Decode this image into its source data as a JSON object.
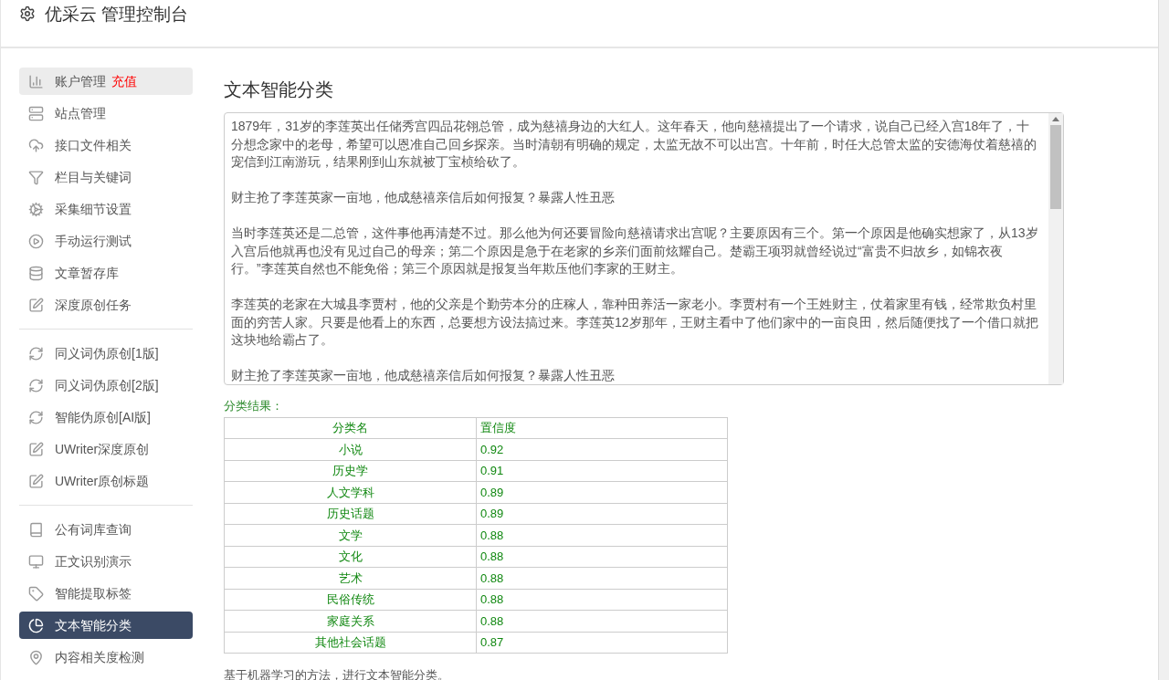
{
  "header": {
    "title": "优采云 管理控制台"
  },
  "sidebar": {
    "groups": [
      {
        "items": [
          {
            "label": "账户管理",
            "badge": "充值",
            "selected": false,
            "highlighted": true
          },
          {
            "label": "站点管理",
            "selected": false,
            "highlighted": false
          },
          {
            "label": "接口文件相关",
            "selected": false,
            "highlighted": false
          },
          {
            "label": "栏目与关键词",
            "selected": false,
            "highlighted": false
          },
          {
            "label": "采集细节设置",
            "selected": false,
            "highlighted": false
          },
          {
            "label": "手动运行测试",
            "selected": false,
            "highlighted": false
          },
          {
            "label": "文章暂存库",
            "selected": false,
            "highlighted": false
          },
          {
            "label": "深度原创任务",
            "selected": false,
            "highlighted": false
          }
        ]
      },
      {
        "items": [
          {
            "label": "同义词伪原创[1版]",
            "selected": false,
            "highlighted": false
          },
          {
            "label": "同义词伪原创[2版]",
            "selected": false,
            "highlighted": false
          },
          {
            "label": "智能伪原创[AI版]",
            "selected": false,
            "highlighted": false
          },
          {
            "label": "UWriter深度原创",
            "selected": false,
            "highlighted": false
          },
          {
            "label": "UWriter原创标题",
            "selected": false,
            "highlighted": false
          }
        ]
      },
      {
        "items": [
          {
            "label": "公有词库查询",
            "selected": false,
            "highlighted": false
          },
          {
            "label": "正文识别演示",
            "selected": false,
            "highlighted": false
          },
          {
            "label": "智能提取标签",
            "selected": false,
            "highlighted": false
          },
          {
            "label": "文本智能分类",
            "selected": true,
            "highlighted": false
          },
          {
            "label": "内容相关度检测",
            "selected": false,
            "highlighted": false
          }
        ]
      }
    ]
  },
  "main": {
    "title": "文本智能分类",
    "text_input": {
      "paragraphs": [
        "1879年，31岁的李莲英出任储秀宫四品花翎总管，成为慈禧身边的大红人。这年春天，他向慈禧提出了一个请求，说自己已经入宫18年了，十分想念家中的老母，希望可以恩准自己回乡探亲。当时清朝有明确的规定，太监无故不可以出宫。十年前，时任大总管太监的安德海仗着慈禧的宠信到江南游玩，结果刚到山东就被丁宝桢给砍了。",
        "财主抢了李莲英家一亩地，他成慈禧亲信后如何报复？暴露人性丑恶",
        "当时李莲英还是二总管，这件事他再清楚不过。那么他为何还要冒险向慈禧请求出宫呢？主要原因有三个。第一个原因是他确实想家了，从13岁入宫后他就再也没有见过自己的母亲；第二个原因是急于在老家的乡亲们面前炫耀自己。楚霸王项羽就曾经说过“富贵不归故乡，如锦衣夜行。”李莲英自然也不能免俗；第三个原因就是报复当年欺压他们李家的王财主。",
        "李莲英的老家在大城县李贾村，他的父亲是个勤劳本分的庄稼人，靠种田养活一家老小。李贾村有一个王姓财主，仗着家里有钱，经常欺负村里面的穷苦人家。只要是他看上的东西，总要想方设法搞过来。李莲英12岁那年，王财主看中了他们家中的一亩良田，然后随便找了一个借口就把这块地给霸占了。",
        "财主抢了李莲英家一亩地，他成慈禧亲信后如何报复？暴露人性丑恶"
      ]
    },
    "result_label": "分类结果：",
    "table": {
      "columns": [
        "分类名",
        "置信度"
      ],
      "rows": [
        [
          "小说",
          "0.92"
        ],
        [
          "历史学",
          "0.91"
        ],
        [
          "人文学科",
          "0.89"
        ],
        [
          "历史话题",
          "0.89"
        ],
        [
          "文学",
          "0.88"
        ],
        [
          "文化",
          "0.88"
        ],
        [
          "艺术",
          "0.88"
        ],
        [
          "民俗传统",
          "0.88"
        ],
        [
          "家庭关系",
          "0.88"
        ],
        [
          "其他社会话题",
          "0.87"
        ]
      ]
    },
    "footnote": "基于机器学习的方法，进行文本智能分类。"
  }
}
